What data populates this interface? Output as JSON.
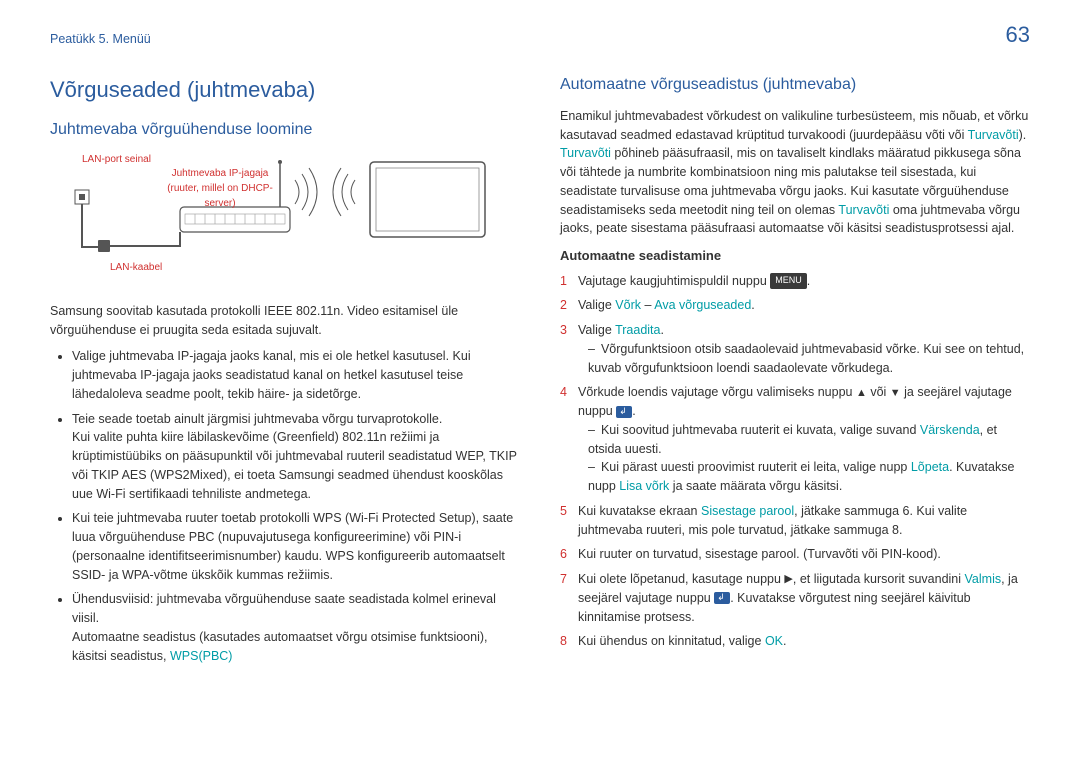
{
  "page_number": "63",
  "breadcrumb": "Peatükk 5. Menüü",
  "left": {
    "title": "Võrguseaded (juhtmevaba)",
    "subtitle": "Juhtmevaba võrguühenduse loomine",
    "diagram_labels": {
      "lan_port": "LAN-port seinal",
      "ip_sharer_a": "Juhtmevaba IP-jagaja",
      "ip_sharer_b": "(ruuter, millel on DHCP-",
      "ip_sharer_c": "server)",
      "lan_cable": "LAN-kaabel"
    },
    "note": "Samsung soovitab kasutada protokolli IEEE 802.11n. Video esitamisel üle võrguühenduse ei pruugita seda esitada sujuvalt.",
    "bullets": [
      "Valige juhtmevaba IP-jagaja jaoks kanal, mis ei ole hetkel kasutusel. Kui juhtmevaba IP-jagaja jaoks seadistatud kanal on hetkel kasutusel teise lähedaloleva seadme poolt, tekib häire- ja sidetõrge.",
      "Teie seade toetab ainult järgmisi juhtmevaba võrgu turvaprotokolle.\nKui valite puhta kiire läbilaskevõime (Greenfield) 802.11n režiimi ja krüptimistüübiks on pääsupunktil või juhtmevabal ruuteril seadistatud WEP, TKIP või TKIP AES (WPS2Mixed), ei toeta Samsungi seadmed ühendust kooskõlas uue Wi-Fi sertifikaadi tehniliste andmetega.",
      "Kui teie juhtmevaba ruuter toetab protokolli WPS (Wi-Fi Protected Setup), saate luua võrguühenduse PBC (nupuvajutusega konfigureerimine) või PIN-i (personaalne identifitseerimisnumber) kaudu. WPS konfigureerib automaatselt SSID- ja WPA-võtme ükskõik kummas režiimis.",
      "Ühendusviisid: juhtmevaba võrguühenduse saate seadistada kolmel erineval viisil.\nAutomaatne seadistus (kasutades automaatset võrgu otsimise funktsiooni), käsitsi seadistus, "
    ],
    "wps_link": "WPS(PBC)"
  },
  "right": {
    "subtitle": "Automaatne võrguseadistus (juhtmevaba)",
    "intro_a": "Enamikul juhtmevabadest võrkudest on valikuline turbesüsteem, mis nõuab, et võrku kasutavad seadmed edastavad krüptitud turvakoodi (juurdepääsu võti või ",
    "intro_a_link": "Turvavõti",
    "intro_a_end": ").",
    "intro_b_link": "Turvavõti",
    "intro_b": " põhineb pääsufraasil, mis on tavaliselt kindlaks määratud pikkusega sõna või tähtede ja numbrite kombinatsioon ning mis palutakse teil sisestada, kui seadistate turvalisuse oma juhtmevaba võrgu jaoks. Kui kasutate võrguühenduse seadistamiseks seda meetodit ning teil on olemas ",
    "intro_b_link2": "Turvavõti",
    "intro_b_end": " oma juhtmevaba võrgu jaoks, peate sisestama pääsufraasi automaatse või käsitsi seadistusprotsessi ajal.",
    "auto_heading": "Automaatne seadistamine",
    "steps": {
      "s1_a": "Vajutage kaugjuhtimispuldil nuppu ",
      "s1_menu": "MENU",
      "s1_b": ".",
      "s2_a": "Valige ",
      "s2_l1": "Võrk",
      "s2_mid": " – ",
      "s2_l2": "Ava võrguseaded",
      "s2_b": ".",
      "s3_a": "Valige ",
      "s3_l": "Traadita",
      "s3_b": ".",
      "s3_d1": "Võrgufunktsioon otsib saadaolevaid juhtmevabasid võrke. Kui see on tehtud, kuvab võrgufunktsioon loendi saadaolevate võrkudega.",
      "s4_a": "Võrkude loendis vajutage võrgu valimiseks nuppu ",
      "s4_or": " või ",
      "s4_b": " ja seejärel vajutage nuppu ",
      "s4_c": ".",
      "s4_d1_a": "Kui soovitud juhtmevaba ruuterit ei kuvata, valige suvand ",
      "s4_d1_l": "Värskenda",
      "s4_d1_b": ", et otsida uuesti.",
      "s4_d2_a": "Kui pärast uuesti proovimist ruuterit ei leita, valige nupp ",
      "s4_d2_l1": "Lõpeta",
      "s4_d2_mid": ". Kuvatakse nupp ",
      "s4_d2_l2": "Lisa võrk",
      "s4_d2_b": " ja saate määrata võrgu käsitsi.",
      "s5_a": "Kui kuvatakse ekraan ",
      "s5_l": "Sisestage parool",
      "s5_b": ", jätkake sammuga 6. Kui valite juhtmevaba ruuteri, mis pole turvatud, jätkake sammuga 8.",
      "s6": "Kui ruuter on turvatud, sisestage parool. (Turvavõti või PIN-kood).",
      "s7_a": "Kui olete lõpetanud, kasutage nuppu ",
      "s7_b": ", et liigutada kursorit suvandini ",
      "s7_l": "Valmis",
      "s7_c": ", ja seejärel vajutage nuppu ",
      "s7_d": ". Kuvatakse võrgutest ning seejärel käivitub kinnitamise protsess.",
      "s8_a": "Kui ühendus on kinnitatud, valige ",
      "s8_l": "OK",
      "s8_b": "."
    }
  }
}
